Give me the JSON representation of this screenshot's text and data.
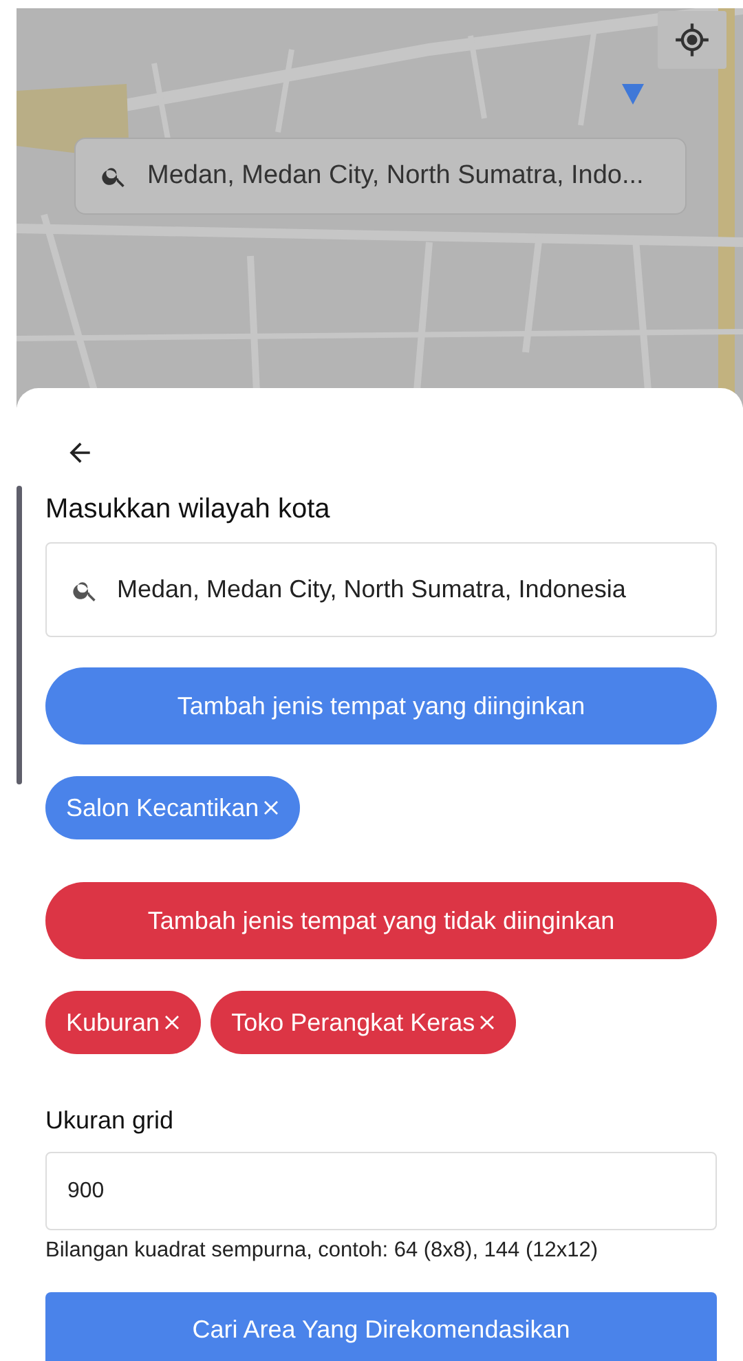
{
  "map": {
    "kind": "picture",
    "search_field": {
      "value": "Medan, Medan City, North Sumatra, Indo..."
    }
  },
  "sheet": {
    "title": "Masukkan wilayah kota",
    "city_field": {
      "value": "Medan, Medan City, North Sumatra, Indonesia"
    },
    "place_filters": [
      {
        "kind": "include",
        "button": "Tambah jenis tempat yang diinginkan",
        "tags": [
          {
            "label": "Salon Kecantikan"
          }
        ]
      },
      {
        "kind": "exclude",
        "button": "Tambah jenis tempat yang tidak diinginkan",
        "tags": [
          {
            "label": "Kuburan"
          },
          {
            "label": "Toko Perangkat Keras"
          }
        ]
      }
    ],
    "grid": {
      "label": "Ukuran grid",
      "value": "900",
      "hint": "Bilangan kuadrat sempurna, contoh: 64 (8x8), 144 (12x12)"
    },
    "submit_button": "Cari Area Yang Direkomendasikan"
  }
}
